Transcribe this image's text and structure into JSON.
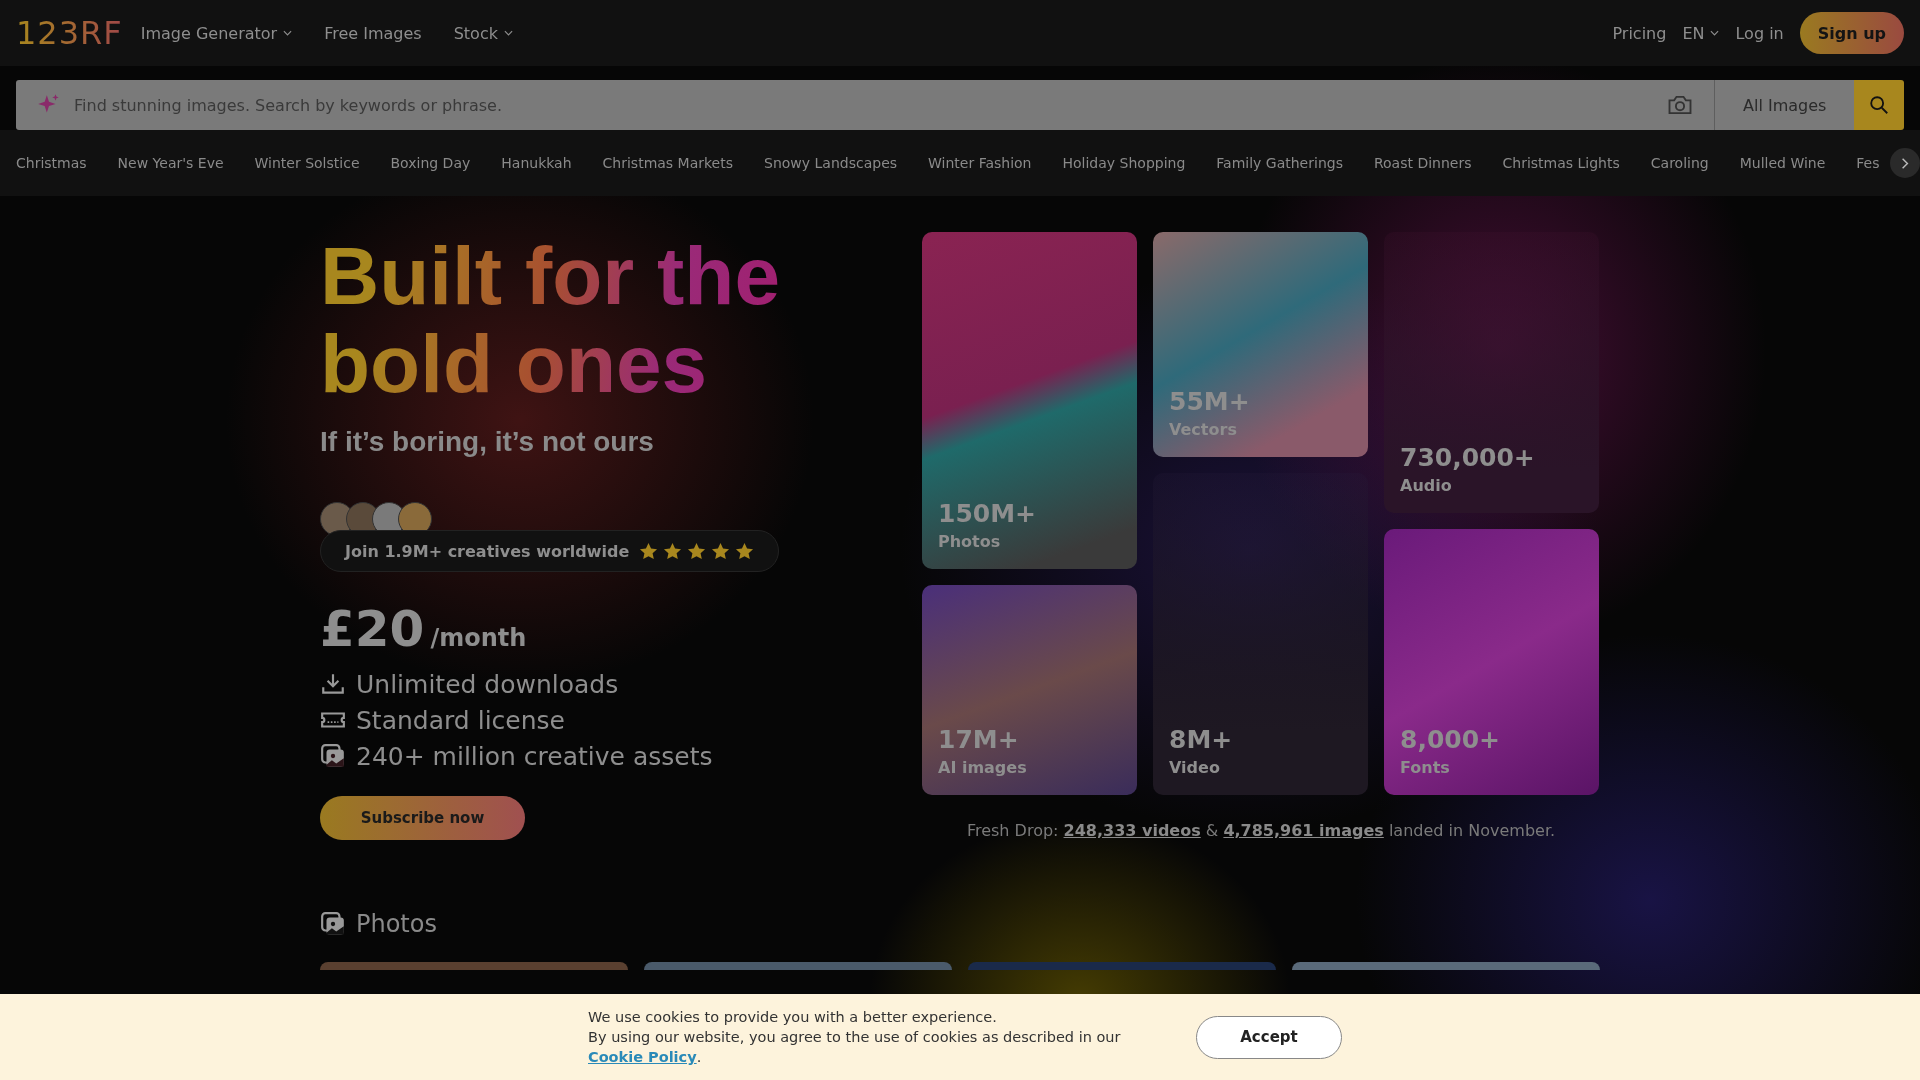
{
  "header": {
    "logo": "123RF",
    "nav": [
      {
        "label": "Image Generator",
        "dropdown": true
      },
      {
        "label": "Free Images",
        "dropdown": false
      },
      {
        "label": "Stock",
        "dropdown": true
      }
    ],
    "pricing": "Pricing",
    "language": "EN",
    "login": "Log in",
    "signup": "Sign up"
  },
  "search": {
    "placeholder": "Find stunning images. Search by keywords or phrase.",
    "filter": "All Images"
  },
  "categories": [
    "Christmas",
    "New Year's Eve",
    "Winter Solstice",
    "Boxing Day",
    "Hanukkah",
    "Christmas Markets",
    "Snowy Landscapes",
    "Winter Fashion",
    "Holiday Shopping",
    "Family Gatherings",
    "Roast Dinners",
    "Christmas Lights",
    "Caroling",
    "Mulled Wine",
    "Fes"
  ],
  "hero": {
    "title": "Built for the bold ones",
    "subtitle": "If it’s boring, it’s not ours",
    "social_proof": {
      "text": "Join 1.9M+ creatives worldwide",
      "stars": 5
    },
    "price": "£20",
    "period": "/month",
    "features": [
      {
        "kind": "download",
        "text": "Unlimited downloads"
      },
      {
        "kind": "license",
        "text": "Standard license"
      },
      {
        "kind": "assets",
        "text": "240+ million creative assets"
      }
    ],
    "cta": "Subscribe now"
  },
  "tiles": [
    {
      "kind": "photos",
      "count": "150M+",
      "label": "Photos"
    },
    {
      "kind": "ai",
      "count": "17M+",
      "label": "AI images"
    },
    {
      "kind": "vectors",
      "count": "55M+",
      "label": "Vectors"
    },
    {
      "kind": "video",
      "count": "8M+",
      "label": "Video"
    },
    {
      "kind": "audio",
      "count": "730,000+",
      "label": "Audio"
    },
    {
      "kind": "fonts",
      "count": "8,000+",
      "label": "Fonts"
    }
  ],
  "fresh_drop": {
    "prefix": "Fresh Drop:",
    "videos_link": "248,333 videos",
    "joiner": "&",
    "images_link": "4,785,961 images",
    "suffix": "landed in November."
  },
  "section": {
    "title": "Photos"
  },
  "cookie": {
    "line1": "We use cookies to provide you with a better experience.",
    "line2": "By using our website, you agree to the use of cookies as described in our",
    "link": "Cookie Policy",
    "end": ".",
    "accept": "Accept"
  }
}
